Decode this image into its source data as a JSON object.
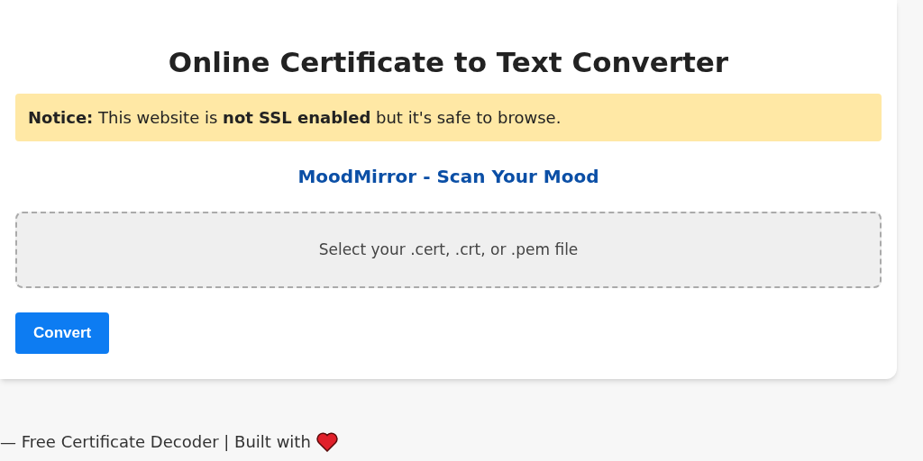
{
  "title": "Online Certificate to Text Converter",
  "notice": "**Notice:** This website is **not SSL enabled** but it's safe to browse.",
  "link": "MoodMirror - Scan Your Mood",
  "file_drop": {
    "label": "Select your .cert, .crt, or .pem file"
  },
  "buttons": [
    "Convert"
  ],
  "footer": "— Free Certificate Decoder | Built with"
}
